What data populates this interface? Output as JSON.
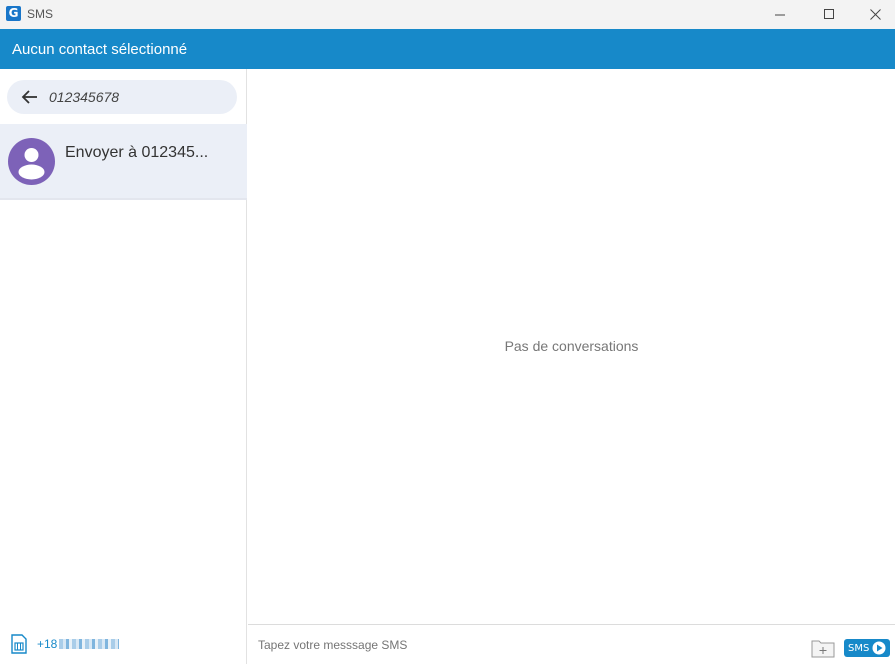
{
  "window": {
    "logo_letter": "G",
    "title": "SMS"
  },
  "header": {
    "title": "Aucun contact sélectionné"
  },
  "sidebar": {
    "search": {
      "value": "012345678"
    },
    "contacts": [
      {
        "label": "Envoyer à 012345..."
      }
    ],
    "sim": {
      "number_prefix": "+18"
    }
  },
  "main": {
    "empty_message": "Pas de conversations"
  },
  "composer": {
    "placeholder": "Tapez votre messsage SMS",
    "send_label": "SMS"
  },
  "colors": {
    "accent": "#1789c9",
    "avatar": "#7d62b8",
    "selected_bg": "#ebeff7"
  }
}
